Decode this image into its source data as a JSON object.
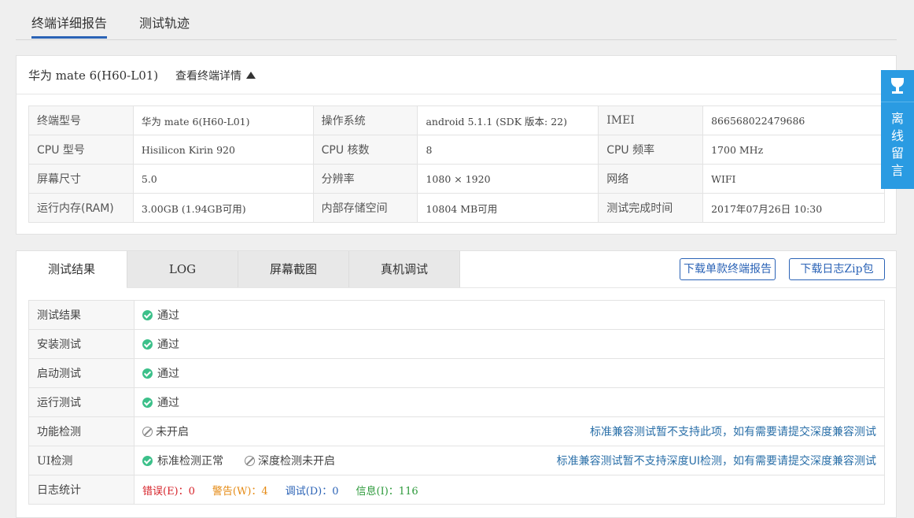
{
  "top_tabs": [
    "终端详细报告",
    "测试轨迹"
  ],
  "device": {
    "title": "华为 mate 6(H60-L01)",
    "detail_link": "查看终端详情",
    "rows": [
      [
        {
          "k": "终端型号",
          "v": "华为 mate 6(H60-L01)"
        },
        {
          "k": "操作系统",
          "v": "android 5.1.1 (SDK 版本: 22)"
        },
        {
          "k": "IMEI",
          "v": "866568022479686"
        }
      ],
      [
        {
          "k": "CPU 型号",
          "v": "Hisilicon Kirin 920"
        },
        {
          "k": "CPU 核数",
          "v": "8"
        },
        {
          "k": "CPU 频率",
          "v": "1700 MHz"
        }
      ],
      [
        {
          "k": "屏幕尺寸",
          "v": "5.0"
        },
        {
          "k": "分辨率",
          "v": "1080 × 1920"
        },
        {
          "k": "网络",
          "v": "WIFI"
        }
      ],
      [
        {
          "k": "运行内存(RAM)",
          "v": "3.00GB (1.94GB可用)"
        },
        {
          "k": "内部存储空间",
          "v": "10804 MB可用"
        },
        {
          "k": "测试完成时间",
          "v": "2017年07月26日 10:30"
        }
      ]
    ]
  },
  "result_tabs": [
    "测试结果",
    "LOG",
    "屏幕截图",
    "真机调试"
  ],
  "buttons": {
    "download_report": "下载单款终端报告",
    "download_log": "下载日志Zip包"
  },
  "results": {
    "test_result": {
      "label": "测试结果",
      "value": "通过"
    },
    "install": {
      "label": "安装测试",
      "value": "通过"
    },
    "launch": {
      "label": "启动测试",
      "value": "通过"
    },
    "run": {
      "label": "运行测试",
      "value": "通过"
    },
    "function": {
      "label": "功能检测",
      "value": "未开启",
      "note": "标准兼容测试暂不支持此项，如有需要请提交深度兼容测试"
    },
    "ui": {
      "label": "UI检测",
      "value1": "标准检测正常",
      "value2": "深度检测未开启",
      "note": "标准兼容测试暂不支持深度UI检测，如有需要请提交深度兼容测试"
    },
    "log": {
      "label": "日志统计",
      "error": "错误(E)：0",
      "warn": "警告(W)：4",
      "debug": "调试(D)：0",
      "info": "信息(I)：116"
    }
  },
  "side": {
    "text": "离线留言"
  },
  "colors": {
    "accent": "#2b63b6",
    "ok": "#3cc08a",
    "side": "#2a9be2"
  }
}
